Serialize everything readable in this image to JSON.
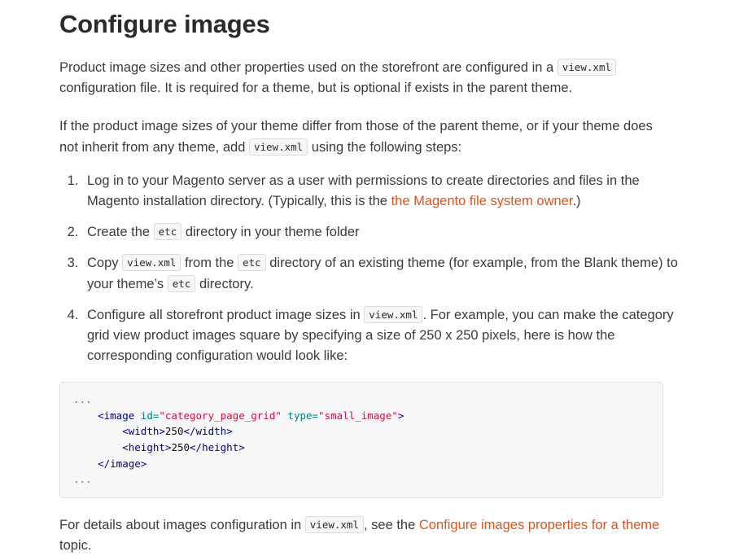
{
  "page": {
    "title": "Configure images",
    "link_color": "#d9541e",
    "text_color": "#3b3b3b",
    "code_bg": "#f7f7f7"
  },
  "intro": {
    "p1_a": "Product image sizes and other properties used on the storefront are configured in a",
    "p1_code": "view.xml",
    "p1_b": "configuration file. It is required for a theme, but is optional if exists in the parent theme.",
    "p2_a": "If the product image sizes of your theme differ from those of the parent theme, or if your theme does not inherit from any theme, add",
    "p2_code": "view.xml",
    "p2_b": "using the following steps:"
  },
  "steps": {
    "s1_a": "Log in to your Magento server as a user with permissions to create directories and files in the Magento installation directory. (Typically, this is the",
    "s1_link": "the Magento file system owner",
    "s1_b": ".)",
    "s2_a": "Create the",
    "s2_code": "etc",
    "s2_b": "directory in your theme folder",
    "s3_a": "Copy",
    "s3_code1": "view.xml",
    "s3_b": "from the",
    "s3_code2": "etc",
    "s3_c": "directory of an existing theme (for example, from the Blank theme) to your theme’s",
    "s3_code3": "etc",
    "s3_d": "directory.",
    "s4_a": "Configure all storefront product image sizes in",
    "s4_code": "view.xml",
    "s4_b": ". For example, you can make the category grid view product images square by specifying a size of 250 x 250 pixels, here is how the corresponding configuration would look like:"
  },
  "code": {
    "language": "xml",
    "dots_top": "...",
    "dots_bottom": "...",
    "line_image_open_tag": "<image",
    "attr_id_name": " id=",
    "attr_id_value": "\"category_page_grid\"",
    "attr_type_name": " type=",
    "attr_type_value": "\"small_image\"",
    "line_image_open_close": ">",
    "width_open": "<width>",
    "width_value": "250",
    "width_close": "</width>",
    "height_open": "<height>",
    "height_value": "250",
    "height_close": "</height>",
    "image_close": "</image>"
  },
  "outro": {
    "a": "For details about images configuration in",
    "code": "view.xml",
    "b": ", see the",
    "link": "Configure images properties for a theme",
    "c": "topic."
  }
}
